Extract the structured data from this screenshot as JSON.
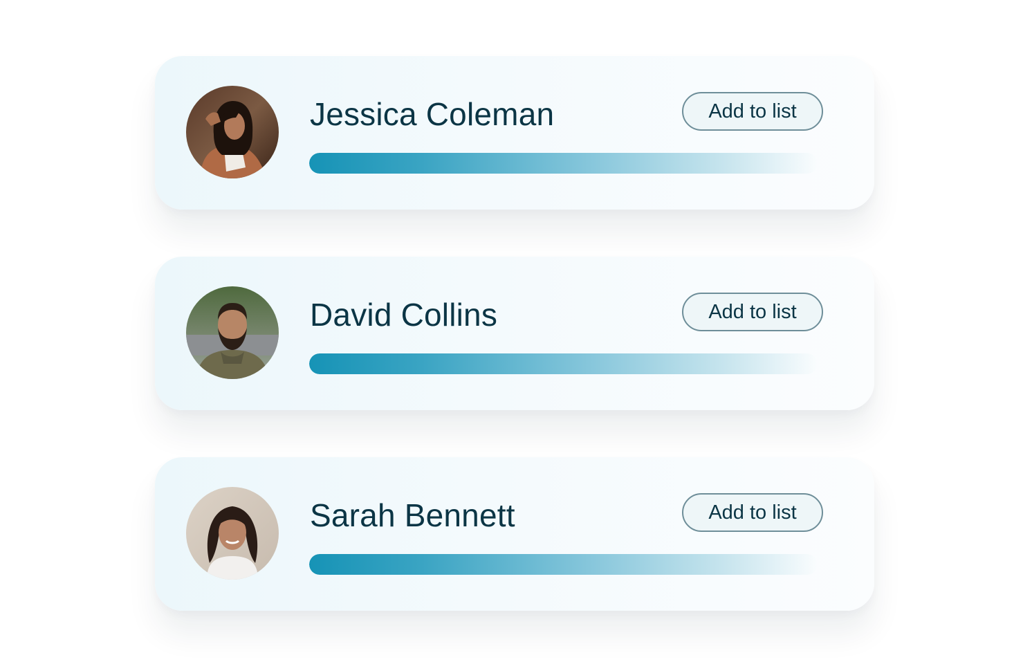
{
  "contacts": [
    {
      "name": "Jessica Coleman",
      "button_label": "Add to list",
      "avatar": "photo-woman-brown-jacket",
      "progress": 1.0
    },
    {
      "name": "David Collins",
      "button_label": "Add to list",
      "avatar": "photo-man-beard-green-hoodie",
      "progress": 1.0
    },
    {
      "name": "Sarah Bennett",
      "button_label": "Add to list",
      "avatar": "photo-girl-smiling",
      "progress": 1.0
    }
  ],
  "colors": {
    "text": "#0b3545",
    "button_border": "#6e8e99",
    "button_bg": "#eef6f8",
    "bar_start": "#1693b6",
    "bar_end": "#e8f4f8",
    "card_bg": "#f1f9fc"
  }
}
